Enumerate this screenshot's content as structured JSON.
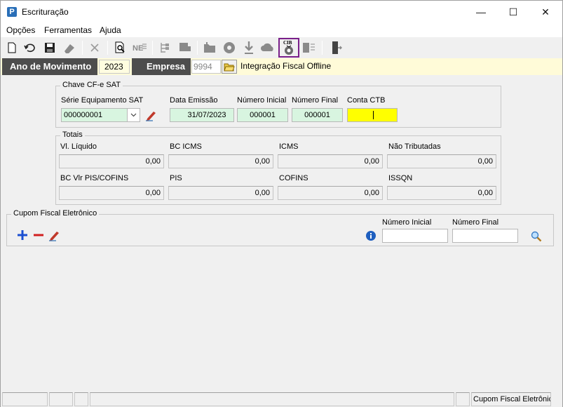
{
  "window": {
    "title": "Escrituração",
    "app_icon_letter": "P",
    "controls": {
      "minimize": "—",
      "maximize": "☐",
      "close": "✕"
    }
  },
  "menu": [
    "Opções",
    "Ferramentas",
    "Ajuda"
  ],
  "toolbar": {
    "highlighted_button": "CIB",
    "highlight_color": "#7a1f8a"
  },
  "infobar": {
    "year_label": "Ano de Movimento",
    "year_value": "2023",
    "company_label": "Empresa",
    "company_code": "9994",
    "company_name": "Integração Fiscal Offline"
  },
  "chave": {
    "title": "Chave CF-e SAT",
    "serie_label": "Série Equipamento SAT",
    "serie_value": "000000001",
    "data_label": "Data Emissão",
    "data_value": "31/07/2023",
    "num_ini_label": "Número Inicial",
    "num_ini_value": "000001",
    "num_fin_label": "Número Final",
    "num_fin_value": "000001",
    "conta_label": "Conta CTB",
    "conta_value": ""
  },
  "totais": {
    "title": "Totais",
    "row1": [
      {
        "label": "Vl. Líquido",
        "value": "0,00"
      },
      {
        "label": "BC ICMS",
        "value": "0,00"
      },
      {
        "label": "ICMS",
        "value": "0,00"
      },
      {
        "label": "Não Tributadas",
        "value": "0,00"
      }
    ],
    "row2": [
      {
        "label": "BC Vlr PIS/COFINS",
        "value": "0,00"
      },
      {
        "label": "PIS",
        "value": "0,00"
      },
      {
        "label": "COFINS",
        "value": "0,00"
      },
      {
        "label": "ISSQN",
        "value": "0,00"
      }
    ]
  },
  "cupom": {
    "title": "Cupom Fiscal Eletrônico",
    "num_ini_label": "Número Inicial",
    "num_ini_value": "",
    "num_fin_label": "Número Final",
    "num_fin_value": ""
  },
  "statusbar": {
    "panel_right": "Cupom Fiscal Eletrônico"
  },
  "colors": {
    "accent_green_field": "#d8f5e0",
    "conta_field": "#ffff00",
    "infobar_bg": "#fffbd8",
    "label_bg": "#4d4d4d"
  }
}
